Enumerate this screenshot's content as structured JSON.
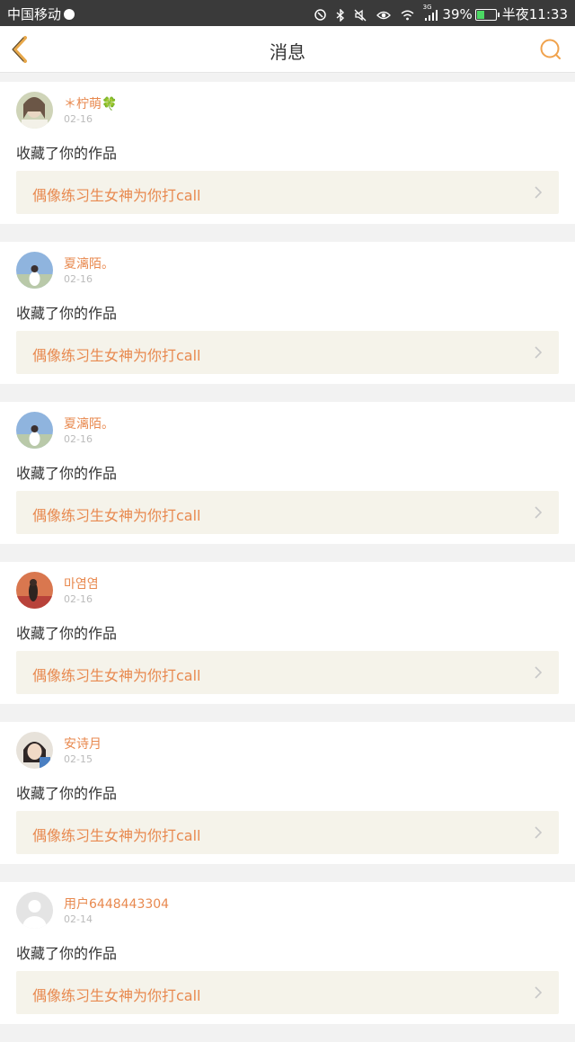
{
  "statusbar": {
    "carrier": "中国移动",
    "network": "3G",
    "battery": "39%",
    "battery_level": 0.39,
    "time": "半夜11:33"
  },
  "header": {
    "title": "消息",
    "back_icon": "chevron-left-icon",
    "search_icon": "search-icon"
  },
  "colors": {
    "accent": "#e8894f",
    "link_bg": "#f5f3ea",
    "page_bg": "#f2f2f2"
  },
  "messages": [
    {
      "user": "＊柠萌🍀",
      "date": "02-16",
      "action": "收藏了你的作品",
      "work": "偶像练习生女神为你打call"
    },
    {
      "user": "夏漓陌。",
      "date": "02-16",
      "action": "收藏了你的作品",
      "work": "偶像练习生女神为你打call"
    },
    {
      "user": "夏漓陌。",
      "date": "02-16",
      "action": "收藏了你的作品",
      "work": "偶像练习生女神为你打call"
    },
    {
      "user": "마염염",
      "date": "02-16",
      "action": "收藏了你的作品",
      "work": "偶像练习生女神为你打call"
    },
    {
      "user": "安诗月",
      "date": "02-15",
      "action": "收藏了你的作品",
      "work": "偶像练习生女神为你打call"
    },
    {
      "user": "用户6448443304",
      "date": "02-14",
      "action": "收藏了你的作品",
      "work": "偶像练习生女神为你打call"
    }
  ]
}
